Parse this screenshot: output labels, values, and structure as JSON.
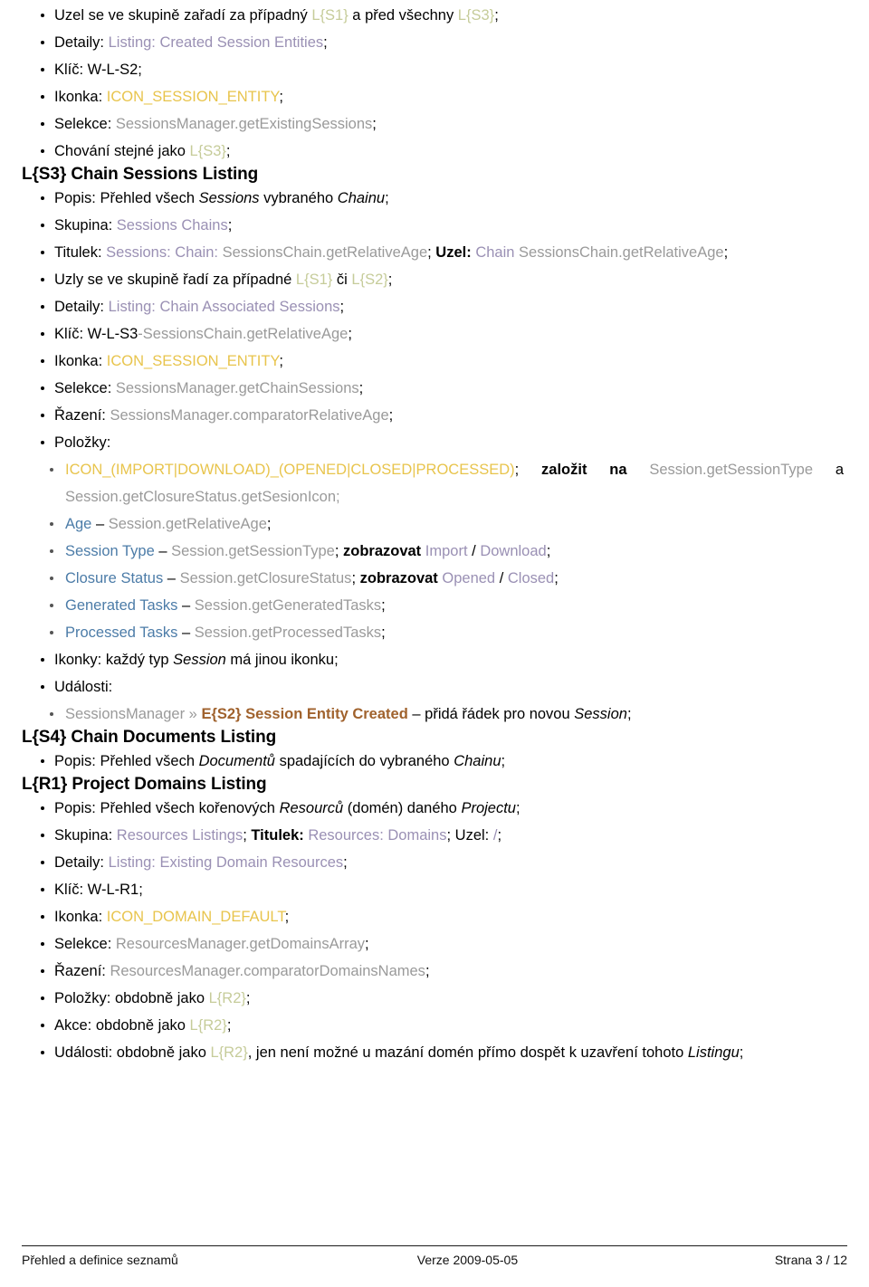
{
  "document": {
    "top_list": [
      {
        "parts": [
          {
            "t": "Uzel se ve skupině zařadí za případný ",
            "c": "blk"
          },
          {
            "t": "L{S1}",
            "c": "green"
          },
          {
            "t": " a před všechny ",
            "c": "blk"
          },
          {
            "t": "L{S3}",
            "c": "green"
          },
          {
            "t": ";",
            "c": "blk"
          }
        ]
      },
      {
        "parts": [
          {
            "t": "Detaily: ",
            "c": "blk"
          },
          {
            "t": "Listing: Created Session Entities",
            "c": "purple"
          },
          {
            "t": ";",
            "c": "blk"
          }
        ]
      },
      {
        "parts": [
          {
            "t": "Klíč: W-L-S2;",
            "c": "blk"
          }
        ]
      },
      {
        "parts": [
          {
            "t": "Ikonka: ",
            "c": "blk"
          },
          {
            "t": "ICON_SESSION_ENTITY",
            "c": "yellow"
          },
          {
            "t": ";",
            "c": "blk"
          }
        ]
      },
      {
        "parts": [
          {
            "t": "Selekce: ",
            "c": "blk"
          },
          {
            "t": "SessionsManager.getExistingSessions",
            "c": "gray"
          },
          {
            "t": ";",
            "c": "blk"
          }
        ]
      },
      {
        "parts": [
          {
            "t": "Chování stejné jako ",
            "c": "blk"
          },
          {
            "t": "L{S3}",
            "c": "green"
          },
          {
            "t": ";",
            "c": "blk"
          }
        ]
      }
    ],
    "section_s3": {
      "heading": "L{S3} Chain Sessions Listing",
      "items": [
        {
          "parts": [
            {
              "t": "Popis: Přehled všech ",
              "c": "blk"
            },
            {
              "t": "Sessions",
              "c": "ital"
            },
            {
              "t": " vybraného ",
              "c": "blk"
            },
            {
              "t": "Chainu",
              "c": "ital"
            },
            {
              "t": ";",
              "c": "blk"
            }
          ]
        },
        {
          "parts": [
            {
              "t": "Skupina: ",
              "c": "blk"
            },
            {
              "t": "Sessions Chains",
              "c": "purple"
            },
            {
              "t": ";",
              "c": "blk"
            }
          ]
        },
        {
          "parts": [
            {
              "t": "Titulek: ",
              "c": "blk"
            },
            {
              "t": "Sessions: Chain: ",
              "c": "purple"
            },
            {
              "t": "SessionsChain.getRelativeAge",
              "c": "gray"
            },
            {
              "t": "; ",
              "c": "blk"
            },
            {
              "t": "Uzel:",
              "c": "bold"
            },
            {
              "t": " ",
              "c": "blk"
            },
            {
              "t": "Chain ",
              "c": "purple"
            },
            {
              "t": "SessionsChain.getRelativeAge",
              "c": "gray"
            },
            {
              "t": ";",
              "c": "blk"
            }
          ]
        },
        {
          "parts": [
            {
              "t": "Uzly se ve skupině řadí za případné ",
              "c": "blk"
            },
            {
              "t": "L{S1}",
              "c": "green"
            },
            {
              "t": " či ",
              "c": "blk"
            },
            {
              "t": "L{S2}",
              "c": "green"
            },
            {
              "t": ";",
              "c": "blk"
            }
          ]
        },
        {
          "parts": [
            {
              "t": "Detaily: ",
              "c": "blk"
            },
            {
              "t": "Listing: Chain Associated Sessions",
              "c": "purple"
            },
            {
              "t": ";",
              "c": "blk"
            }
          ]
        },
        {
          "parts": [
            {
              "t": "Klíč: W-L-S3",
              "c": "blk"
            },
            {
              "t": "-SessionsChain.getRelativeAge",
              "c": "gray"
            },
            {
              "t": ";",
              "c": "blk"
            }
          ]
        },
        {
          "parts": [
            {
              "t": "Ikonka: ",
              "c": "blk"
            },
            {
              "t": "ICON_SESSION_ENTITY",
              "c": "yellow"
            },
            {
              "t": ";",
              "c": "blk"
            }
          ]
        },
        {
          "parts": [
            {
              "t": "Selekce: ",
              "c": "blk"
            },
            {
              "t": "SessionsManager.getChainSessions",
              "c": "gray"
            },
            {
              "t": ";",
              "c": "blk"
            }
          ]
        },
        {
          "parts": [
            {
              "t": "Řazení: ",
              "c": "blk"
            },
            {
              "t": "SessionsManager.comparatorRelativeAge",
              "c": "gray"
            },
            {
              "t": ";",
              "c": "blk"
            }
          ]
        },
        {
          "parts": [
            {
              "t": "Položky:",
              "c": "blk"
            }
          ]
        }
      ],
      "polozky_sub": [
        {
          "justify": true,
          "parts": [
            {
              "t": "ICON_(IMPORT|DOWNLOAD)_(OPENED|CLOSED|PROCESSED)",
              "c": "yellow"
            },
            {
              "t": "; ",
              "c": "blk"
            },
            {
              "t": "založit na",
              "c": "bold"
            },
            {
              "t": " ",
              "c": "blk"
            },
            {
              "t": "Session.getSessionType",
              "c": "gray"
            },
            {
              "t": " a ",
              "c": "blk"
            },
            {
              "t": "Session.getClosureStatus.getSesionIcon;",
              "c": "gray"
            }
          ]
        },
        {
          "parts": [
            {
              "t": "Age",
              "c": "blue"
            },
            {
              "t": " – ",
              "c": "blk"
            },
            {
              "t": "Session.getRelativeAge",
              "c": "gray"
            },
            {
              "t": ";",
              "c": "blk"
            }
          ]
        },
        {
          "parts": [
            {
              "t": "Session Type",
              "c": "blue"
            },
            {
              "t": " – ",
              "c": "blk"
            },
            {
              "t": "Session.getSessionType",
              "c": "gray"
            },
            {
              "t": "; ",
              "c": "blk"
            },
            {
              "t": "zobrazovat",
              "c": "bold"
            },
            {
              "t": " ",
              "c": "blk"
            },
            {
              "t": "Import",
              "c": "purple"
            },
            {
              "t": " / ",
              "c": "blk"
            },
            {
              "t": "Download",
              "c": "purple"
            },
            {
              "t": ";",
              "c": "blk"
            }
          ]
        },
        {
          "parts": [
            {
              "t": "Closure Status",
              "c": "blue"
            },
            {
              "t": " – ",
              "c": "blk"
            },
            {
              "t": "Session.getClosureStatus",
              "c": "gray"
            },
            {
              "t": "; ",
              "c": "blk"
            },
            {
              "t": "zobrazovat",
              "c": "bold"
            },
            {
              "t": " ",
              "c": "blk"
            },
            {
              "t": "Opened",
              "c": "purple"
            },
            {
              "t": " / ",
              "c": "blk"
            },
            {
              "t": "Closed",
              "c": "purple"
            },
            {
              "t": ";",
              "c": "blk"
            }
          ]
        },
        {
          "parts": [
            {
              "t": "Generated Tasks",
              "c": "blue"
            },
            {
              "t": " – ",
              "c": "blk"
            },
            {
              "t": "Session.getGeneratedTasks",
              "c": "gray"
            },
            {
              "t": ";",
              "c": "blk"
            }
          ]
        },
        {
          "parts": [
            {
              "t": "Processed Tasks",
              "c": "blue"
            },
            {
              "t": " – ",
              "c": "blk"
            },
            {
              "t": "Session.getProcessedTasks",
              "c": "gray"
            },
            {
              "t": ";",
              "c": "blk"
            }
          ]
        }
      ],
      "items_tail": [
        {
          "parts": [
            {
              "t": "Ikonky: každý typ ",
              "c": "blk"
            },
            {
              "t": "Session",
              "c": "ital"
            },
            {
              "t": " má jinou ikonku;",
              "c": "blk"
            }
          ]
        },
        {
          "parts": [
            {
              "t": "Události:",
              "c": "blk"
            }
          ]
        }
      ],
      "udalosti_sub": [
        {
          "parts": [
            {
              "t": "SessionsManager",
              "c": "gray"
            },
            {
              "t": " ",
              "c": "blk"
            },
            {
              "t": "»",
              "c": "gray"
            },
            {
              "t": " ",
              "c": "blk"
            },
            {
              "t": "E{S2} Session Entity Created",
              "c": "brown"
            },
            {
              "t": " – přidá řádek pro novou ",
              "c": "blk"
            },
            {
              "t": "Session",
              "c": "ital"
            },
            {
              "t": ";",
              "c": "blk"
            }
          ]
        }
      ]
    },
    "section_s4": {
      "heading": "L{S4} Chain Documents Listing",
      "items": [
        {
          "parts": [
            {
              "t": "Popis: Přehled všech ",
              "c": "blk"
            },
            {
              "t": "Documentů",
              "c": "ital"
            },
            {
              "t": " spadajících do vybraného ",
              "c": "blk"
            },
            {
              "t": "Chainu",
              "c": "ital"
            },
            {
              "t": ";",
              "c": "blk"
            }
          ]
        }
      ]
    },
    "section_r1": {
      "heading": "L{R1} Project Domains Listing",
      "items": [
        {
          "parts": [
            {
              "t": "Popis: Přehled všech kořenových ",
              "c": "blk"
            },
            {
              "t": "Resourců",
              "c": "ital"
            },
            {
              "t": " (domén) daného ",
              "c": "blk"
            },
            {
              "t": "Projectu",
              "c": "ital"
            },
            {
              "t": ";",
              "c": "blk"
            }
          ]
        },
        {
          "parts": [
            {
              "t": "Skupina: ",
              "c": "blk"
            },
            {
              "t": "Resources Listings",
              "c": "purple"
            },
            {
              "t": "; ",
              "c": "blk"
            },
            {
              "t": "Titulek:",
              "c": "bold"
            },
            {
              "t": " ",
              "c": "blk"
            },
            {
              "t": "Resources: Domains",
              "c": "purple"
            },
            {
              "t": "; ",
              "c": "blk"
            },
            {
              "t": "Uzel:",
              "c": "blk"
            },
            {
              "t": " ",
              "c": "blk"
            },
            {
              "t": "/",
              "c": "purple"
            },
            {
              "t": ";",
              "c": "blk"
            }
          ]
        },
        {
          "parts": [
            {
              "t": "Detaily: ",
              "c": "blk"
            },
            {
              "t": "Listing: Existing Domain Resources",
              "c": "purple"
            },
            {
              "t": ";",
              "c": "blk"
            }
          ]
        },
        {
          "parts": [
            {
              "t": "Klíč: W-L-R1;",
              "c": "blk"
            }
          ]
        },
        {
          "parts": [
            {
              "t": "Ikonka: ",
              "c": "blk"
            },
            {
              "t": "ICON_DOMAIN_DEFAULT",
              "c": "yellow"
            },
            {
              "t": ";",
              "c": "blk"
            }
          ]
        },
        {
          "parts": [
            {
              "t": "Selekce: ",
              "c": "blk"
            },
            {
              "t": "ResourcesManager.getDomainsArray",
              "c": "gray"
            },
            {
              "t": ";",
              "c": "blk"
            }
          ]
        },
        {
          "parts": [
            {
              "t": "Řazení: ",
              "c": "blk"
            },
            {
              "t": "ResourcesManager.comparatorDomainsNames",
              "c": "gray"
            },
            {
              "t": ";",
              "c": "blk"
            }
          ]
        },
        {
          "parts": [
            {
              "t": "Položky: obdobně jako ",
              "c": "blk"
            },
            {
              "t": "L{R2}",
              "c": "green"
            },
            {
              "t": ";",
              "c": "blk"
            }
          ]
        },
        {
          "parts": [
            {
              "t": "Akce: obdobně jako ",
              "c": "blk"
            },
            {
              "t": "L{R2}",
              "c": "green"
            },
            {
              "t": ";",
              "c": "blk"
            }
          ]
        },
        {
          "parts": [
            {
              "t": "Události: obdobně jako ",
              "c": "blk"
            },
            {
              "t": "L{R2}",
              "c": "green"
            },
            {
              "t": ", jen není možné u mazání domén přímo dospět k uzavření tohoto ",
              "c": "blk"
            },
            {
              "t": "Listingu",
              "c": "ital"
            },
            {
              "t": ";",
              "c": "blk"
            }
          ]
        }
      ]
    }
  },
  "footer": {
    "left": "Přehled a definice seznamů",
    "center": "Verze 2009-05-05",
    "right": "Strana 3 / 12"
  },
  "colors": {
    "text": "#000000",
    "gray": "#9a9a9a",
    "purple": "#9a90b4",
    "yellow": "#e8c44c",
    "green": "#c6cc9a",
    "blue": "#4c7ca8",
    "brown": "#a0622d",
    "background": "#ffffff"
  }
}
